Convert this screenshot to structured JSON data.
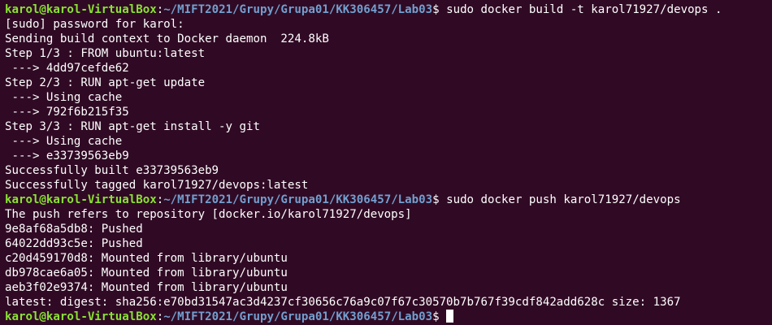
{
  "colors": {
    "background": "#300a24",
    "text": "#ffffff",
    "user_host": "#8ae234",
    "path": "#729fcf"
  },
  "prompt": {
    "user_host": "karol@karol-VirtualBox",
    "separator": ":",
    "path": "~/MIFT2021/Grupy/Grupa01/KK306457/Lab03",
    "symbol": "$ "
  },
  "commands": [
    "sudo docker build -t karol71927/devops .",
    "sudo docker push karol71927/devops"
  ],
  "build_output": [
    "[sudo] password for karol:",
    "Sending build context to Docker daemon  224.8kB",
    "Step 1/3 : FROM ubuntu:latest",
    " ---> 4dd97cefde62",
    "Step 2/3 : RUN apt-get update",
    " ---> Using cache",
    " ---> 792f6b215f35",
    "Step 3/3 : RUN apt-get install -y git",
    " ---> Using cache",
    " ---> e33739563eb9",
    "Successfully built e33739563eb9",
    "Successfully tagged karol71927/devops:latest"
  ],
  "push_output": [
    "The push refers to repository [docker.io/karol71927/devops]",
    "9e8af68a5db8: Pushed",
    "64022dd93c5e: Pushed",
    "c20d459170d8: Mounted from library/ubuntu",
    "db978cae6a05: Mounted from library/ubuntu",
    "aeb3f02e9374: Mounted from library/ubuntu",
    "latest: digest: sha256:e70bd31547ac3d4237cf30656c76a9c07f67c30570b7b767f39cdf842add628c size: 1367"
  ]
}
